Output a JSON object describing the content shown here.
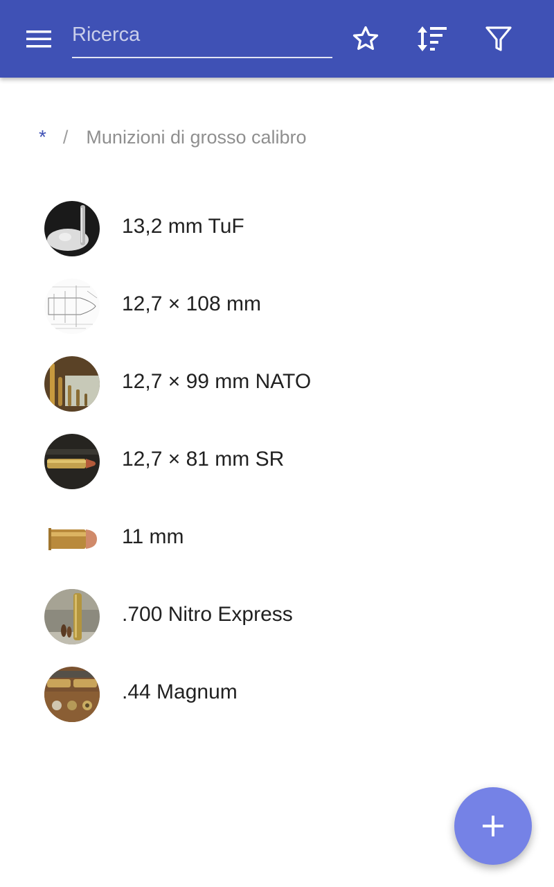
{
  "appbar": {
    "search": {
      "placeholder": "Ricerca",
      "value": ""
    },
    "icons": [
      "menu-icon",
      "star-icon",
      "sort-icon",
      "filter-icon"
    ],
    "background_color": "#3f51b5"
  },
  "breadcrumb": {
    "root": "*",
    "separator": "/",
    "current": "Munizioni di grosso calibro"
  },
  "items": [
    {
      "label": "13,2 mm TuF"
    },
    {
      "label": "12,7 × 108 mm"
    },
    {
      "label": "12,7 × 99 mm NATO"
    },
    {
      "label": "12,7 × 81 mm SR"
    },
    {
      "label": "11 mm"
    },
    {
      "label": ".700 Nitro Express"
    },
    {
      "label": ".44 Magnum"
    }
  ],
  "fab": {
    "icon": "add-icon",
    "color": "#7582e6"
  }
}
